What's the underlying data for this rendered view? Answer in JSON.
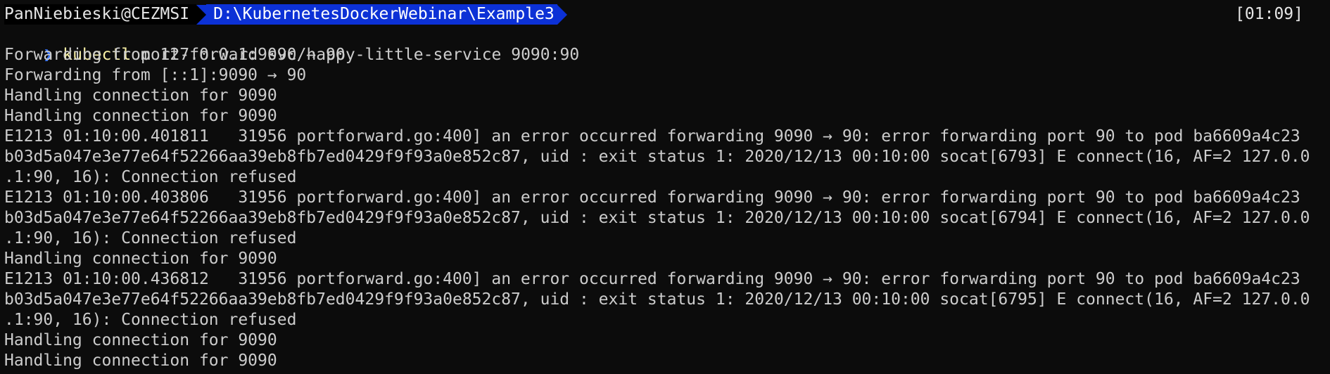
{
  "prompt": {
    "user_host": "PanNiebieski@CEZMSI",
    "path": "D:\\KubernetesDockerWebinar\\Example3",
    "clock": "[01:09]",
    "chevron": "❯",
    "command_name": "kubectl",
    "command_args": "port-forward svc/happy-little-service 9090:90"
  },
  "output": [
    "Forwarding from 127.0.0.1:9090 -> 90",
    "Forwarding from [::1]:9090 -> 90",
    "Handling connection for 9090",
    "Handling connection for 9090",
    "E1213 01:10:00.401811   31956 portforward.go:400] an error occurred forwarding 9090 -> 90: error forwarding port 90 to pod ba6609a4c23",
    "b03d5a047e3e77e64f52266aa39eb8fb7ed0429f9f93a0e852c87, uid : exit status 1: 2020/12/13 00:10:00 socat[6793] E connect(16, AF=2 127.0.0",
    ".1:90, 16): Connection refused",
    "E1213 01:10:00.403806   31956 portforward.go:400] an error occurred forwarding 9090 -> 90: error forwarding port 90 to pod ba6609a4c23",
    "b03d5a047e3e77e64f52266aa39eb8fb7ed0429f9f93a0e852c87, uid : exit status 1: 2020/12/13 00:10:00 socat[6794] E connect(16, AF=2 127.0.0",
    ".1:90, 16): Connection refused",
    "Handling connection for 9090",
    "E1213 01:10:00.436812   31956 portforward.go:400] an error occurred forwarding 9090 -> 90: error forwarding port 90 to pod ba6609a4c23",
    "b03d5a047e3e77e64f52266aa39eb8fb7ed0429f9f93a0e852c87, uid : exit status 1: 2020/12/13 00:10:00 socat[6795] E connect(16, AF=2 127.0.0",
    ".1:90, 16): Connection refused",
    "Handling connection for 9090",
    "Handling connection for 9090"
  ],
  "colors": {
    "background": "#0c0c0c",
    "text": "#cccccc",
    "path_segment": "#0c31d6",
    "command": "#f9f1a5",
    "chevron": "#3b78ff"
  }
}
